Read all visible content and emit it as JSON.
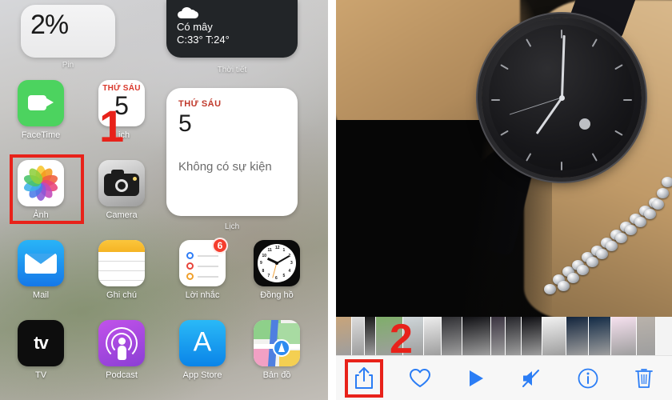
{
  "left_screen": {
    "name": "ios-home-screen",
    "widgets": [
      {
        "id": "battery-widget",
        "value": "2%",
        "label": "Pin"
      },
      {
        "id": "weather-widget",
        "icon": "cloud-icon",
        "condition": "Có mây",
        "temps": "C:33° T:24°",
        "label": "Thời tiết"
      },
      {
        "id": "calendar-widget",
        "weekday": "THỨ SÁU",
        "day": "5",
        "event_text": "Không có sự kiện",
        "label": "Lịch"
      }
    ],
    "apps": [
      {
        "name": "FaceTime",
        "icon": "facetime-icon",
        "badge": ""
      },
      {
        "name": "Lịch",
        "icon": "calendar-icon",
        "badge": "",
        "weekday": "THỨ SÁU",
        "day": "5"
      },
      {
        "name": "Ảnh",
        "icon": "photos-icon",
        "badge": "",
        "highlighted": true
      },
      {
        "name": "Camera",
        "icon": "camera-icon",
        "badge": ""
      },
      {
        "name": "Mail",
        "icon": "mail-icon",
        "badge": ""
      },
      {
        "name": "Ghi chú",
        "icon": "notes-icon",
        "badge": ""
      },
      {
        "name": "Lời nhắc",
        "icon": "reminders-icon",
        "badge": "6"
      },
      {
        "name": "Đồng hồ",
        "icon": "clock-icon",
        "badge": ""
      },
      {
        "name": "TV",
        "icon": "tv-icon",
        "badge": "",
        "glyph": "tv"
      },
      {
        "name": "Podcast",
        "icon": "podcast-icon",
        "badge": ""
      },
      {
        "name": "App Store",
        "icon": "appstore-icon",
        "badge": "",
        "glyph": "A"
      },
      {
        "name": "Bản đồ",
        "icon": "maps-icon",
        "badge": ""
      }
    ],
    "annotation": {
      "step_number": "1",
      "highlight_target": "Ảnh"
    }
  },
  "right_screen": {
    "name": "photos-viewer",
    "photo_description": "wristwatch-photo",
    "annotation": {
      "step_number": "2",
      "highlight_target": "share-button"
    },
    "toolbar": [
      {
        "id": "share-button",
        "icon": "share-icon",
        "label": "Chia sẻ",
        "highlighted": true
      },
      {
        "id": "favorite-button",
        "icon": "heart-icon",
        "label": "Yêu thích",
        "highlighted": false
      },
      {
        "id": "play-button",
        "icon": "play-icon",
        "label": "Phát",
        "highlighted": false
      },
      {
        "id": "mute-button",
        "icon": "mute-icon",
        "label": "Tắt tiếng",
        "highlighted": false
      },
      {
        "id": "info-button",
        "icon": "info-icon",
        "label": "Thông tin",
        "highlighted": false
      },
      {
        "id": "delete-button",
        "icon": "trash-icon",
        "label": "Xoá",
        "highlighted": false
      }
    ],
    "filmstrip_thumbnails": [
      "#c8a47a",
      "#dcdcdc",
      "#1b1b1b",
      "#7fae6a",
      "#cfd6d9",
      "#ededed",
      "#2f2f33",
      "#101014",
      "#3a3340",
      "#26262b",
      "#0e0e12",
      "#f2f2f2",
      "#12243c",
      "#122a45",
      "#f6e1ef",
      "#b9b2ab"
    ]
  },
  "accent_colors": {
    "annotation_red": "#e8221a",
    "ios_blue": "#2b7df5",
    "badge_red": "#f53e2e"
  }
}
